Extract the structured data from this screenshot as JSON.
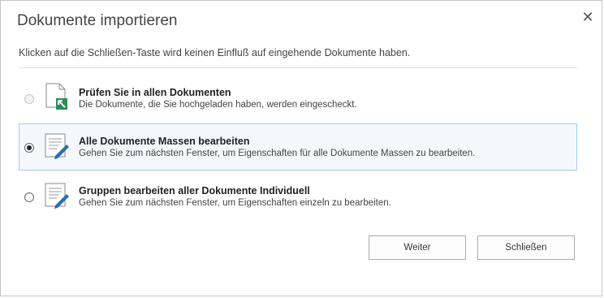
{
  "dialog": {
    "title": "Dokumente importieren",
    "close_icon": "close-icon",
    "description": "Klicken auf die Schließen-Taste wird keinen Einfluß auf eingehende Dokumente haben."
  },
  "options": [
    {
      "title": "Prüfen Sie in allen Dokumenten",
      "subtitle": "Die Dokumente, die Sie hochgeladen haben, werden eingescheckt.",
      "icon": "document-checkin-icon",
      "selected": false,
      "disabled": true
    },
    {
      "title": "Alle Dokumente Massen bearbeiten",
      "subtitle": "Gehen Sie zum nächsten Fenster, um Eigenschaften für alle Dokumente Massen zu bearbeiten.",
      "icon": "document-edit-icon",
      "selected": true,
      "disabled": false
    },
    {
      "title": "Gruppen bearbeiten aller Dokumente Individuell",
      "subtitle": "Gehen Sie zum nächsten Fenster, um Eigenschaften einzeln zu bearbeiten.",
      "icon": "document-edit-icon",
      "selected": false,
      "disabled": false
    }
  ],
  "buttons": {
    "next_label": "Weiter",
    "close_label": "Schließen"
  },
  "colors": {
    "selection_background": "#f4f8fc",
    "selection_border": "#a8cbe9",
    "checkin_arrow": "#2e8b57",
    "edit_pencil": "#2a6fb0"
  }
}
